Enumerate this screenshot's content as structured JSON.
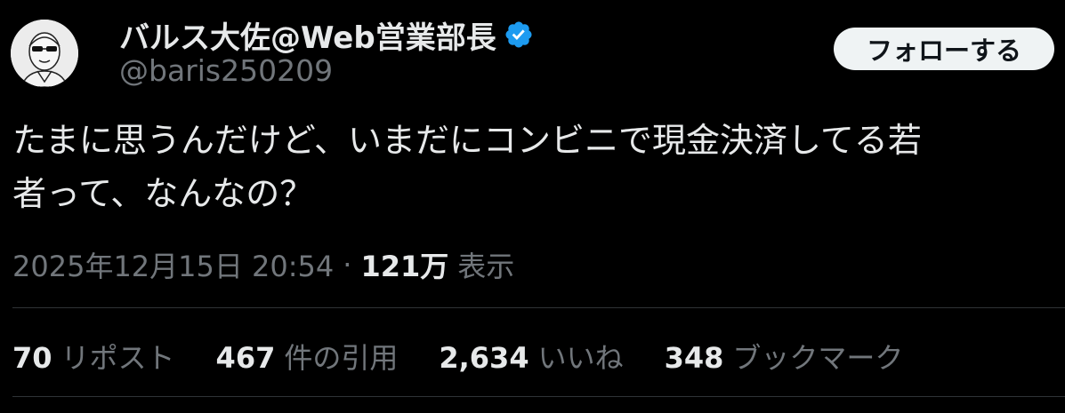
{
  "author": {
    "display_name": "バルス大佐@Web営業部長",
    "handle": "@baris250209",
    "verified_icon": "verified-badge-icon",
    "verified_color": "#1d9bf0"
  },
  "follow_button": {
    "label": "フォローする"
  },
  "tweet": {
    "text_line_1": "たまに思うんだけど、いまだにコンビニで現金決済してる若",
    "text_line_2": "者って、なんなの？"
  },
  "meta": {
    "datetime": "2025年12月15日 20:54",
    "separator": "·",
    "views_count": "121万",
    "views_label": "表示"
  },
  "stats": [
    {
      "value": "70",
      "label": "リポスト"
    },
    {
      "value": "467",
      "label": "件の引用"
    },
    {
      "value": "2,634",
      "label": "いいね"
    },
    {
      "value": "348",
      "label": "ブックマーク"
    }
  ],
  "colors": {
    "background": "#000000",
    "primary_text": "#e7e9ea",
    "secondary_text": "#71767b",
    "divider": "#2f3336",
    "follow_button_bg": "#eff3f4"
  }
}
